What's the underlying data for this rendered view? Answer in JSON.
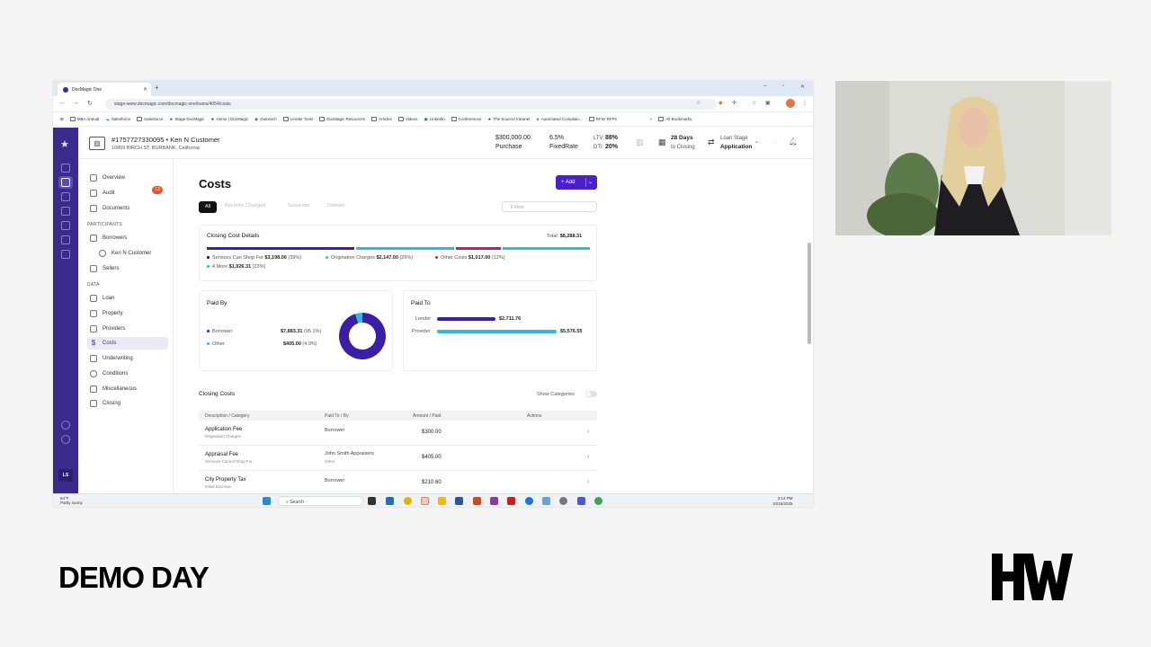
{
  "browser": {
    "tab_title": "DocMagic One",
    "url": "stage-www.docmagic.com/docmagic-one/loans/4054/costs",
    "bookmarks": [
      "MBA Annual",
      "Salesforce",
      "Salesforce",
      "Stage DocMagic",
      "Home | DocMagic",
      "Outreach",
      "Lender Tools",
      "DocMagic Resources",
      "Articles",
      "Videos",
      "LinkedIn",
      "Conferences",
      "The Source/ Intranet",
      "Automated Complian...",
      "RFIs/ RFPs",
      "All Bookmarks"
    ]
  },
  "loan": {
    "id": "#1757727330095 • Ken N Customer",
    "address": "10855 BIRCH ST, BURBANK, California",
    "amount": "$300,000.00",
    "purpose": "Purchase",
    "rate": "6.5%",
    "rate_type": "FixedRate",
    "ltv_label": "LTV:",
    "ltv": "88%",
    "dti_label": "DTI:",
    "dti": "20%",
    "days": "28 Days",
    "days_sub": "to Closing",
    "stage_label": "Loan Stage",
    "stage": "Application"
  },
  "rail": {
    "avatar": "LS"
  },
  "sidebar": {
    "items_top": [
      {
        "label": "Overview"
      },
      {
        "label": "Audit",
        "badge": "13"
      },
      {
        "label": "Documents"
      }
    ],
    "participants_header": "PARTICIPANTS",
    "participants": [
      {
        "label": "Borrowers"
      },
      {
        "label": "Ken N Customer"
      },
      {
        "label": "Sellers"
      }
    ],
    "data_header": "DATA",
    "data_items": [
      {
        "label": "Loan"
      },
      {
        "label": "Property"
      },
      {
        "label": "Providers"
      },
      {
        "label": "Costs"
      },
      {
        "label": "Underwriting"
      },
      {
        "label": "Conditions"
      },
      {
        "label": "Miscellaneous"
      },
      {
        "label": "Closing"
      }
    ]
  },
  "main": {
    "title": "Costs",
    "add_label": "+ Add",
    "filters": [
      "All",
      "Recently Changed",
      "Suspense",
      "Deleted"
    ],
    "filter_placeholder": "Filter",
    "closing_cost_details": {
      "title": "Closing Cost Details",
      "total_label": "Total:",
      "total": "$8,288.31",
      "legend": [
        {
          "label": "Services Can Shop For",
          "amount": "$3,198.00",
          "pct": "(39%)",
          "color": "#3a1fa6"
        },
        {
          "label": "Origination Charges",
          "amount": "$2,147.00",
          "pct": "(26%)",
          "color": "#35b6e0"
        },
        {
          "label": "Other Costs",
          "amount": "$1,017.00",
          "pct": "(12%)",
          "color": "#b3207b"
        },
        {
          "label": "4 More",
          "amount": "$1,926.31",
          "pct": "(23%)",
          "color": "#2ec4b6"
        }
      ]
    },
    "paid_by": {
      "title": "Paid By",
      "rows": [
        {
          "label": "Borrower",
          "amount": "$7,883.31",
          "pct": "(95.1%)",
          "color": "#3a1fa6",
          "value": 95.1
        },
        {
          "label": "Other",
          "amount": "$405.00",
          "pct": "(4.9%)",
          "color": "#35b6e0",
          "value": 4.9
        }
      ]
    },
    "paid_to": {
      "title": "Paid To",
      "rows": [
        {
          "label": "Lender",
          "amount": "$2,711.76",
          "color": "#3a1fa6",
          "value": 2711.76
        },
        {
          "label": "Provider",
          "amount": "$5,576.55",
          "color": "#35b6e0",
          "value": 5576.55
        }
      ]
    },
    "closing_costs": {
      "title": "Closing Costs",
      "toggle_label": "Show Categories",
      "columns": [
        "Description / Category",
        "Paid To / By",
        "Amount / Paid",
        "Actions"
      ],
      "rows": [
        {
          "desc": "Application Fee",
          "cat": "Origination Charges",
          "paid": "Borrower",
          "paid_to": "",
          "amount": "$300.00"
        },
        {
          "desc": "Appraisal Fee",
          "cat": "Services Cannot Shop For",
          "paid": "John Smith Appraisers",
          "paid_to": "Other",
          "amount": "$405.00"
        },
        {
          "desc": "City Property Tax",
          "cat": "Initial Escrows",
          "paid": "Borrower",
          "paid_to": "",
          "amount": "$210.60"
        }
      ]
    }
  },
  "taskbar": {
    "weather_temp": "64°F",
    "weather_desc": "Partly sunny",
    "search": "Search",
    "time": "3:14 PM",
    "date": "10/16/2025"
  },
  "brand": {
    "demo_day": "DEMO DAY",
    "hw": "HW"
  }
}
